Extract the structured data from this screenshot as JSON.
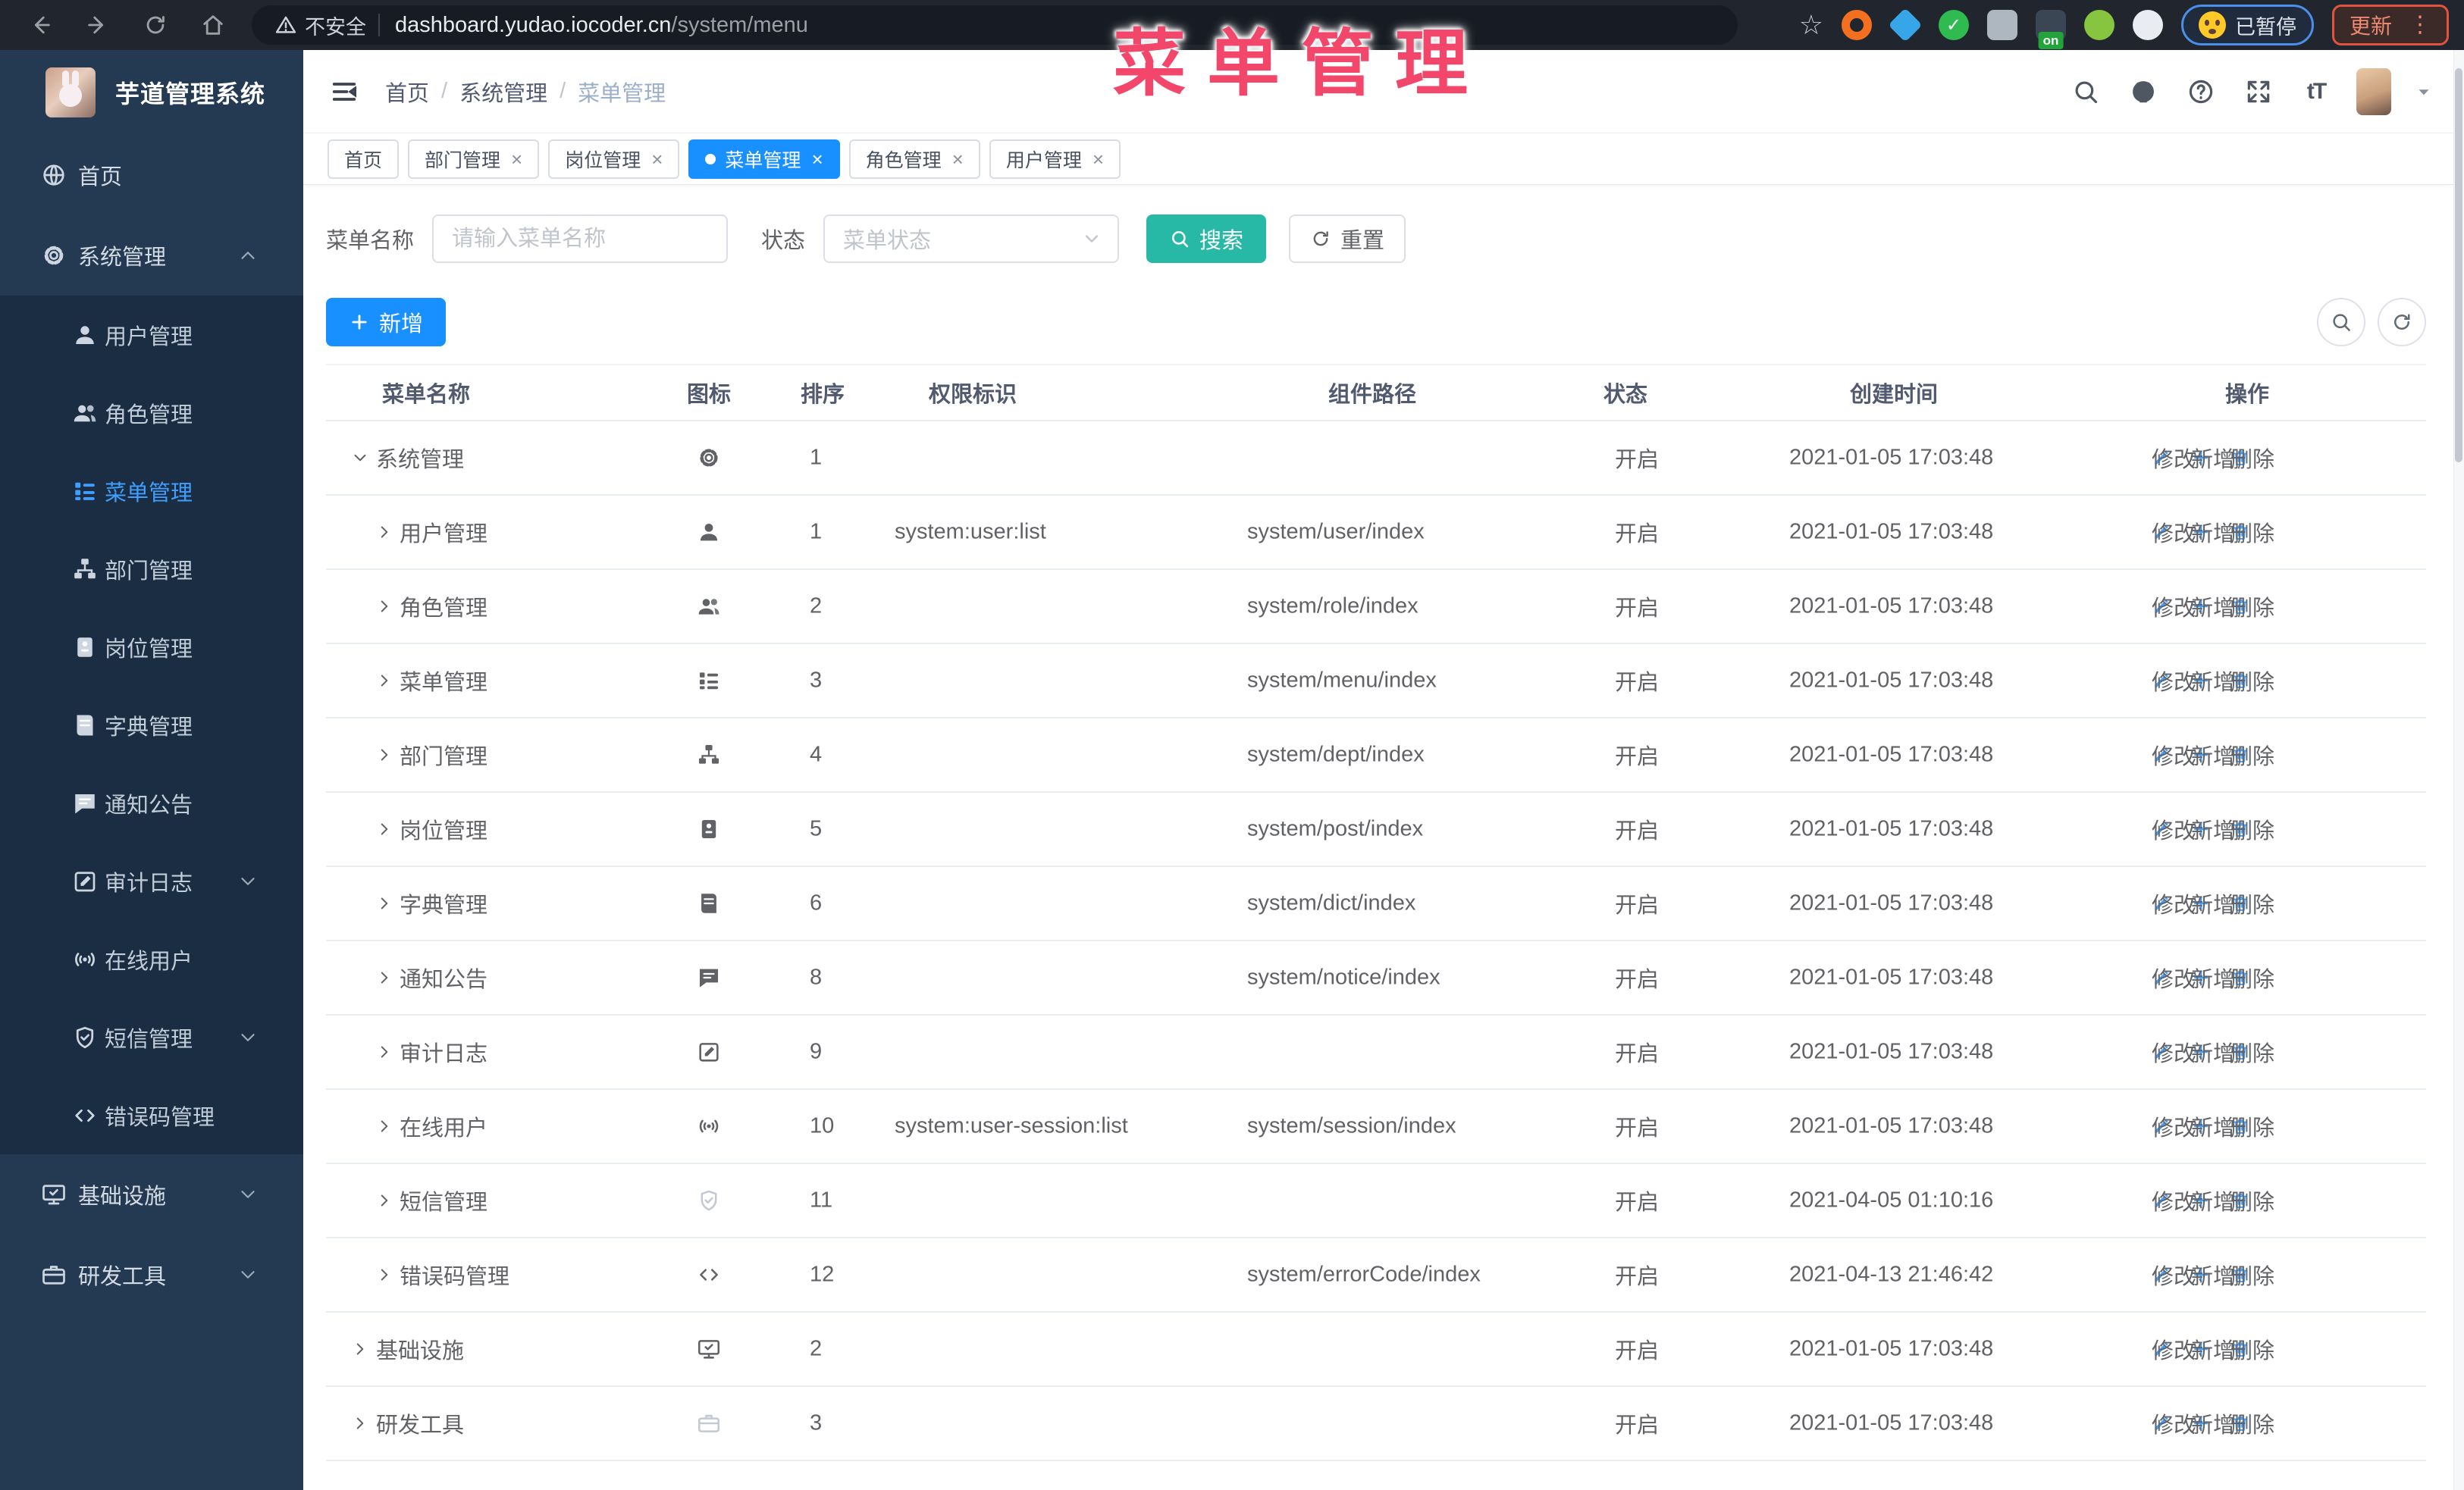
{
  "browser": {
    "security_label": "不安全",
    "url_domain": "dashboard.yudao.iocoder.cn",
    "url_path": "/system/menu",
    "paused_label": "已暂停",
    "update_label": "更新",
    "extensions": [
      {
        "name": "extension-orange-icon",
        "color": "#f4701f",
        "shape": "ring"
      },
      {
        "name": "extension-gem-icon",
        "color": "#37a6e8",
        "shape": "gem"
      },
      {
        "name": "extension-check-icon",
        "color": "#2fbb4f",
        "shape": "circle-check"
      },
      {
        "name": "extension-tiles-icon",
        "color": "#aeb6bf",
        "shape": "tiles"
      },
      {
        "name": "extension-switch-icon",
        "color": "#3b4654",
        "shape": "square",
        "badge": "on"
      },
      {
        "name": "extension-key-icon",
        "color": "#87c540",
        "shape": "circle"
      },
      {
        "name": "extension-puzzle-icon",
        "color": "#e9edf2",
        "shape": "circle"
      }
    ]
  },
  "annotation": {
    "text": "菜单管理",
    "color": "#f2466b"
  },
  "sidebar": {
    "app_title": "芋道管理系统",
    "items": [
      {
        "label": "首页",
        "icon": "globe-icon",
        "type": "top"
      },
      {
        "label": "系统管理",
        "icon": "gear-icon",
        "type": "top",
        "chevron": "up"
      },
      {
        "label": "用户管理",
        "icon": "user-icon",
        "type": "sub"
      },
      {
        "label": "角色管理",
        "icon": "users-icon",
        "type": "sub"
      },
      {
        "label": "菜单管理",
        "icon": "menu-list-icon",
        "type": "sub",
        "active": true
      },
      {
        "label": "部门管理",
        "icon": "tree-icon",
        "type": "sub"
      },
      {
        "label": "岗位管理",
        "icon": "badge-icon",
        "type": "sub"
      },
      {
        "label": "字典管理",
        "icon": "book-icon",
        "type": "sub"
      },
      {
        "label": "通知公告",
        "icon": "message-icon",
        "type": "sub"
      },
      {
        "label": "审计日志",
        "icon": "edit-icon",
        "type": "sub",
        "chevron": "down"
      },
      {
        "label": "在线用户",
        "icon": "signal-icon",
        "type": "sub"
      },
      {
        "label": "短信管理",
        "icon": "shield-icon",
        "type": "sub",
        "chevron": "down"
      },
      {
        "label": "错误码管理",
        "icon": "code-icon",
        "type": "sub"
      },
      {
        "label": "基础设施",
        "icon": "monitor-icon",
        "type": "top",
        "chevron": "down"
      },
      {
        "label": "研发工具",
        "icon": "briefcase-icon",
        "type": "top",
        "chevron": "down"
      }
    ]
  },
  "header": {
    "breadcrumb": [
      "首页",
      "系统管理",
      "菜单管理"
    ]
  },
  "tabs": [
    {
      "label": "首页",
      "closable": false,
      "active": false
    },
    {
      "label": "部门管理",
      "closable": true,
      "active": false
    },
    {
      "label": "岗位管理",
      "closable": true,
      "active": false
    },
    {
      "label": "菜单管理",
      "closable": true,
      "active": true
    },
    {
      "label": "角色管理",
      "closable": true,
      "active": false
    },
    {
      "label": "用户管理",
      "closable": true,
      "active": false
    }
  ],
  "filters": {
    "name_label": "菜单名称",
    "name_placeholder": "请输入菜单名称",
    "status_label": "状态",
    "status_placeholder": "菜单状态",
    "search_label": "搜索",
    "reset_label": "重置"
  },
  "toolbar": {
    "add_label": "新增"
  },
  "table": {
    "columns": [
      "菜单名称",
      "图标",
      "排序",
      "权限标识",
      "组件路径",
      "状态",
      "创建时间",
      "操作"
    ],
    "actions": [
      "修改",
      "新增",
      "删除"
    ],
    "rows": [
      {
        "name": "系统管理",
        "level": 0,
        "caret": "expanded",
        "icon": "gear-icon",
        "sort": "1",
        "perms": "",
        "component": "",
        "status": "开启",
        "time": "2021-01-05 17:03:48"
      },
      {
        "name": "用户管理",
        "level": 1,
        "caret": "collapsed",
        "icon": "user-icon",
        "sort": "1",
        "perms": "system:user:list",
        "component": "system/user/index",
        "status": "开启",
        "time": "2021-01-05 17:03:48"
      },
      {
        "name": "角色管理",
        "level": 1,
        "caret": "collapsed",
        "icon": "users-icon",
        "sort": "2",
        "perms": "",
        "component": "system/role/index",
        "status": "开启",
        "time": "2021-01-05 17:03:48"
      },
      {
        "name": "菜单管理",
        "level": 1,
        "caret": "collapsed",
        "icon": "menu-list-icon",
        "sort": "3",
        "perms": "",
        "component": "system/menu/index",
        "status": "开启",
        "time": "2021-01-05 17:03:48"
      },
      {
        "name": "部门管理",
        "level": 1,
        "caret": "collapsed",
        "icon": "tree-icon",
        "sort": "4",
        "perms": "",
        "component": "system/dept/index",
        "status": "开启",
        "time": "2021-01-05 17:03:48"
      },
      {
        "name": "岗位管理",
        "level": 1,
        "caret": "collapsed",
        "icon": "badge-icon",
        "sort": "5",
        "perms": "",
        "component": "system/post/index",
        "status": "开启",
        "time": "2021-01-05 17:03:48"
      },
      {
        "name": "字典管理",
        "level": 1,
        "caret": "collapsed",
        "icon": "book-icon",
        "sort": "6",
        "perms": "",
        "component": "system/dict/index",
        "status": "开启",
        "time": "2021-01-05 17:03:48"
      },
      {
        "name": "通知公告",
        "level": 1,
        "caret": "collapsed",
        "icon": "message-icon",
        "sort": "8",
        "perms": "",
        "component": "system/notice/index",
        "status": "开启",
        "time": "2021-01-05 17:03:48"
      },
      {
        "name": "审计日志",
        "level": 1,
        "caret": "collapsed",
        "icon": "edit-icon",
        "sort": "9",
        "perms": "",
        "component": "",
        "status": "开启",
        "time": "2021-01-05 17:03:48"
      },
      {
        "name": "在线用户",
        "level": 1,
        "caret": "collapsed",
        "icon": "signal-icon",
        "sort": "10",
        "perms": "system:user-session:list",
        "component": "system/session/index",
        "status": "开启",
        "time": "2021-01-05 17:03:48"
      },
      {
        "name": "短信管理",
        "level": 1,
        "caret": "collapsed",
        "icon": "shield-icon",
        "icon_muted": true,
        "sort": "11",
        "perms": "",
        "component": "",
        "status": "开启",
        "time": "2021-04-05 01:10:16"
      },
      {
        "name": "错误码管理",
        "level": 1,
        "caret": "collapsed",
        "icon": "code-icon",
        "sort": "12",
        "perms": "",
        "component": "system/errorCode/index",
        "status": "开启",
        "time": "2021-04-13 21:46:42"
      },
      {
        "name": "基础设施",
        "level": 0,
        "caret": "collapsed",
        "icon": "monitor-icon",
        "sort": "2",
        "perms": "",
        "component": "",
        "status": "开启",
        "time": "2021-01-05 17:03:48"
      },
      {
        "name": "研发工具",
        "level": 0,
        "caret": "collapsed",
        "icon": "briefcase-icon",
        "icon_muted": true,
        "sort": "3",
        "perms": "",
        "component": "",
        "status": "开启",
        "time": "2021-01-05 17:03:48"
      }
    ]
  }
}
